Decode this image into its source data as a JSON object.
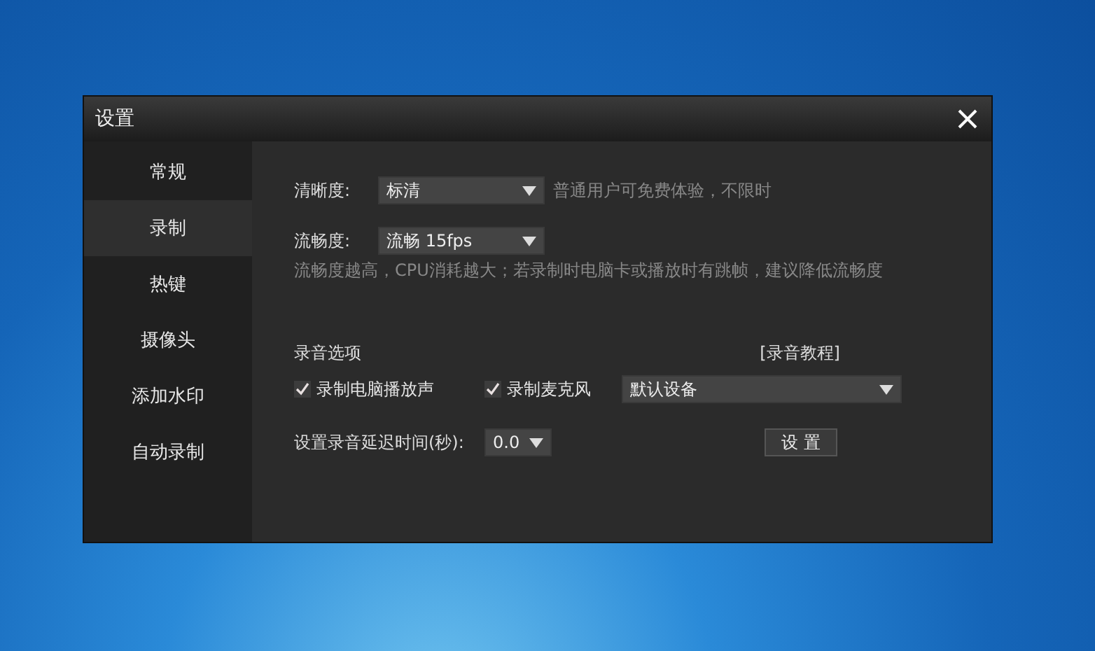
{
  "window": {
    "title": "设置"
  },
  "sidebar": {
    "items": [
      {
        "label": "常规",
        "selected": false
      },
      {
        "label": "录制",
        "selected": true
      },
      {
        "label": "热键",
        "selected": false
      },
      {
        "label": "摄像头",
        "selected": false
      },
      {
        "label": "添加水印",
        "selected": false
      },
      {
        "label": "自动录制",
        "selected": false
      }
    ]
  },
  "clarity": {
    "label": "清晰度:",
    "value": "标清",
    "note": "普通用户可免费体验，不限时"
  },
  "fluency": {
    "label": "流畅度:",
    "value": "流畅 15fps",
    "note": "流畅度越高，CPU消耗越大；若录制时电脑卡或播放时有跳帧，建议降低流畅度"
  },
  "audio": {
    "title": "录音选项",
    "tutorial_link": "[录音教程]",
    "options": [
      {
        "label": "录制电脑播放声",
        "checked": true
      },
      {
        "label": "录制麦克风",
        "checked": true
      }
    ],
    "device": "默认设备",
    "delay_label": "设置录音延迟时间(秒):",
    "delay_value": "0.0",
    "settings_button": "设 置"
  }
}
